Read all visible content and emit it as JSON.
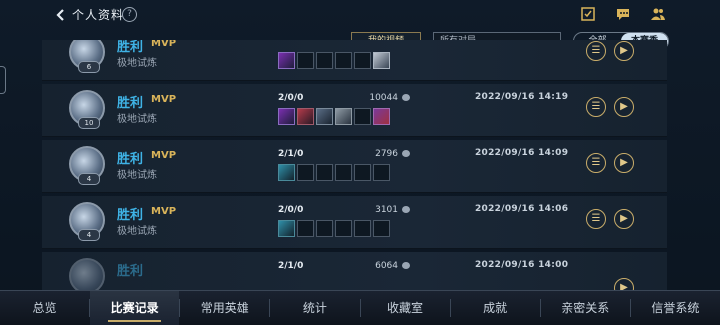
{
  "header": {
    "title": "个人资料",
    "help_label": "?",
    "icons": [
      "checklist-icon",
      "message-icon",
      "friends-icon"
    ]
  },
  "filters": {
    "my_video_label": "我的视频",
    "match_select_value": "所有对局",
    "season_toggle": [
      "全部",
      "本赛季"
    ],
    "season_selected": "本赛季"
  },
  "matches": [
    {
      "result": "胜利",
      "mvp": "MVP",
      "mode": "极地试炼",
      "level": "6",
      "kda": "",
      "score": "",
      "datetime": "",
      "items": [
        "f1",
        "",
        "",
        "",
        "",
        "f6"
      ]
    },
    {
      "result": "胜利",
      "mvp": "MVP",
      "mode": "极地试炼",
      "level": "10",
      "kda": "2/0/0",
      "score": "10044",
      "datetime": "2022/09/16 14:19",
      "items": [
        "f1",
        "f2",
        "f3",
        "f5",
        "",
        "f7"
      ]
    },
    {
      "result": "胜利",
      "mvp": "MVP",
      "mode": "极地试炼",
      "level": "4",
      "kda": "2/1/0",
      "score": "2796",
      "datetime": "2022/09/16 14:09",
      "items": [
        "f4",
        "",
        "",
        "",
        "",
        ""
      ]
    },
    {
      "result": "胜利",
      "mvp": "MVP",
      "mode": "极地试炼",
      "level": "4",
      "kda": "2/0/0",
      "score": "3101",
      "datetime": "2022/09/16 14:06",
      "items": [
        "f4",
        "",
        "",
        "",
        "",
        ""
      ]
    },
    {
      "result": "胜利",
      "mvp": "",
      "mode": "",
      "level": "",
      "kda": "2/1/0",
      "score": "6064",
      "datetime": "2022/09/16 14:00",
      "items": []
    }
  ],
  "row_actions": [
    "list-icon",
    "replay-icon"
  ],
  "nav": {
    "tabs": [
      "总览",
      "比赛记录",
      "常用英雄",
      "统计",
      "收藏室",
      "成就",
      "亲密关系",
      "信誉系统"
    ],
    "active": "比赛记录"
  },
  "colors": {
    "win": "#3fb3e6",
    "mvp": "#d9b45a",
    "accent": "#c9ad6a"
  }
}
